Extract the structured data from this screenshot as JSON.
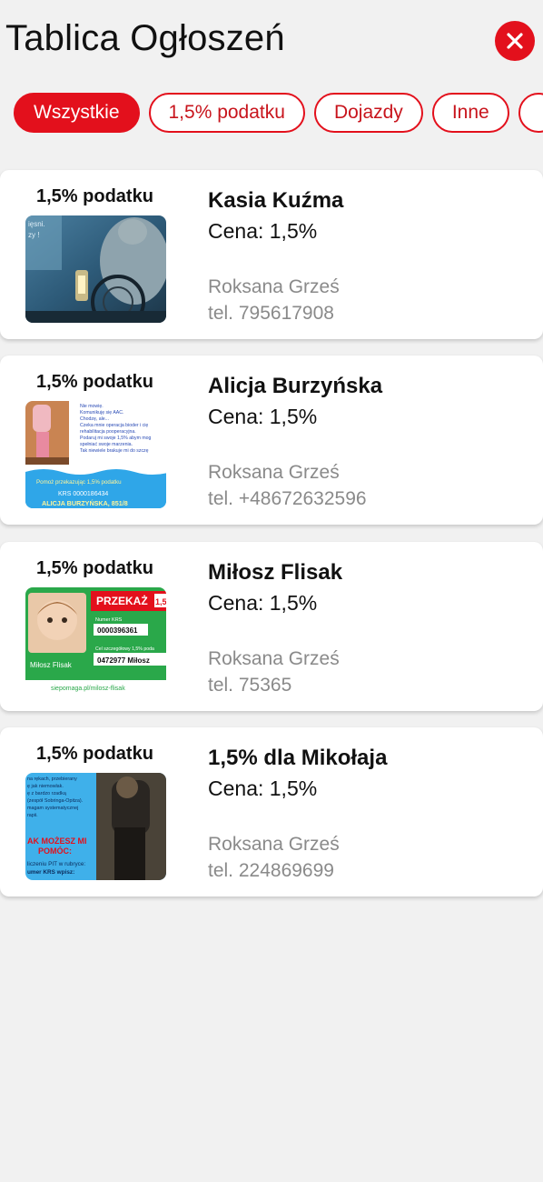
{
  "header": {
    "title": "Tablica Ogłoszeń",
    "close_icon": "close-icon",
    "accent_color": "#e3101c"
  },
  "filters": [
    {
      "label": "Wszystkie",
      "active": true
    },
    {
      "label": "1,5% podatku",
      "active": false
    },
    {
      "label": "Dojazdy",
      "active": false
    },
    {
      "label": "Inne",
      "active": false
    },
    {
      "label": "",
      "active": false
    }
  ],
  "listings": [
    {
      "category": "1,5% podatku",
      "title": "Kasia Kuźma",
      "price": "Cena: 1,5%",
      "author": "Roksana Grześ",
      "phone": "tel. 795617908",
      "thumb_text": [
        "ięsni.",
        "zy !"
      ]
    },
    {
      "category": "1,5% podatku",
      "title": "Alicja Burzyńska",
      "price": "Cena: 1,5%",
      "author": "Roksana Grześ",
      "phone": "tel. +48672632596",
      "thumb_text": [
        "Nie mowię.",
        "Komunikuję się AAC.",
        "Chodzę, ale...",
        "Czeka mnie operacja bioder i cię",
        "rehabilitacja pooperacyjna.",
        "Podaruj mi swoje 1,5% abym mog",
        "spełniać swoje marzenia.",
        "Tak niewiele brakuje mi do szczę",
        "Pomoż przekazując 1,5% podatku",
        "KRS 0000186434",
        "ALICJA BURZYŃSKA, 851/8"
      ]
    },
    {
      "category": "1,5% podatku",
      "title": "Miłosz Flisak",
      "price": "Cena: 1,5%",
      "author": "Roksana Grześ",
      "phone": "tel. 75365",
      "thumb_text": [
        "PRZEKAŻ",
        "1,5",
        "Numer KRS",
        "0000396361",
        "Cel szczegółowy 1,5% poda",
        "0472977 Miłosz",
        "Miłosz Flisak",
        "siepomaga.pl/milosz-flisak"
      ]
    },
    {
      "category": "1,5% podatku",
      "title": "1,5% dla Mikołaja",
      "price": "Cena: 1,5%",
      "author": "Roksana Grześ",
      "phone": "tel. 224869699",
      "thumb_text": [
        "na rękach, przebierany",
        "ę jak niemowlak.",
        "ę z bardzo rzadką",
        "(zespół Sobringa-Opitza).",
        "magam systematycznej",
        "rapii.",
        "AK MOŻESZ MI",
        "POMÓC:",
        "liczeniu PIT w rubryce:",
        "umer KRS wpisz:"
      ]
    }
  ]
}
